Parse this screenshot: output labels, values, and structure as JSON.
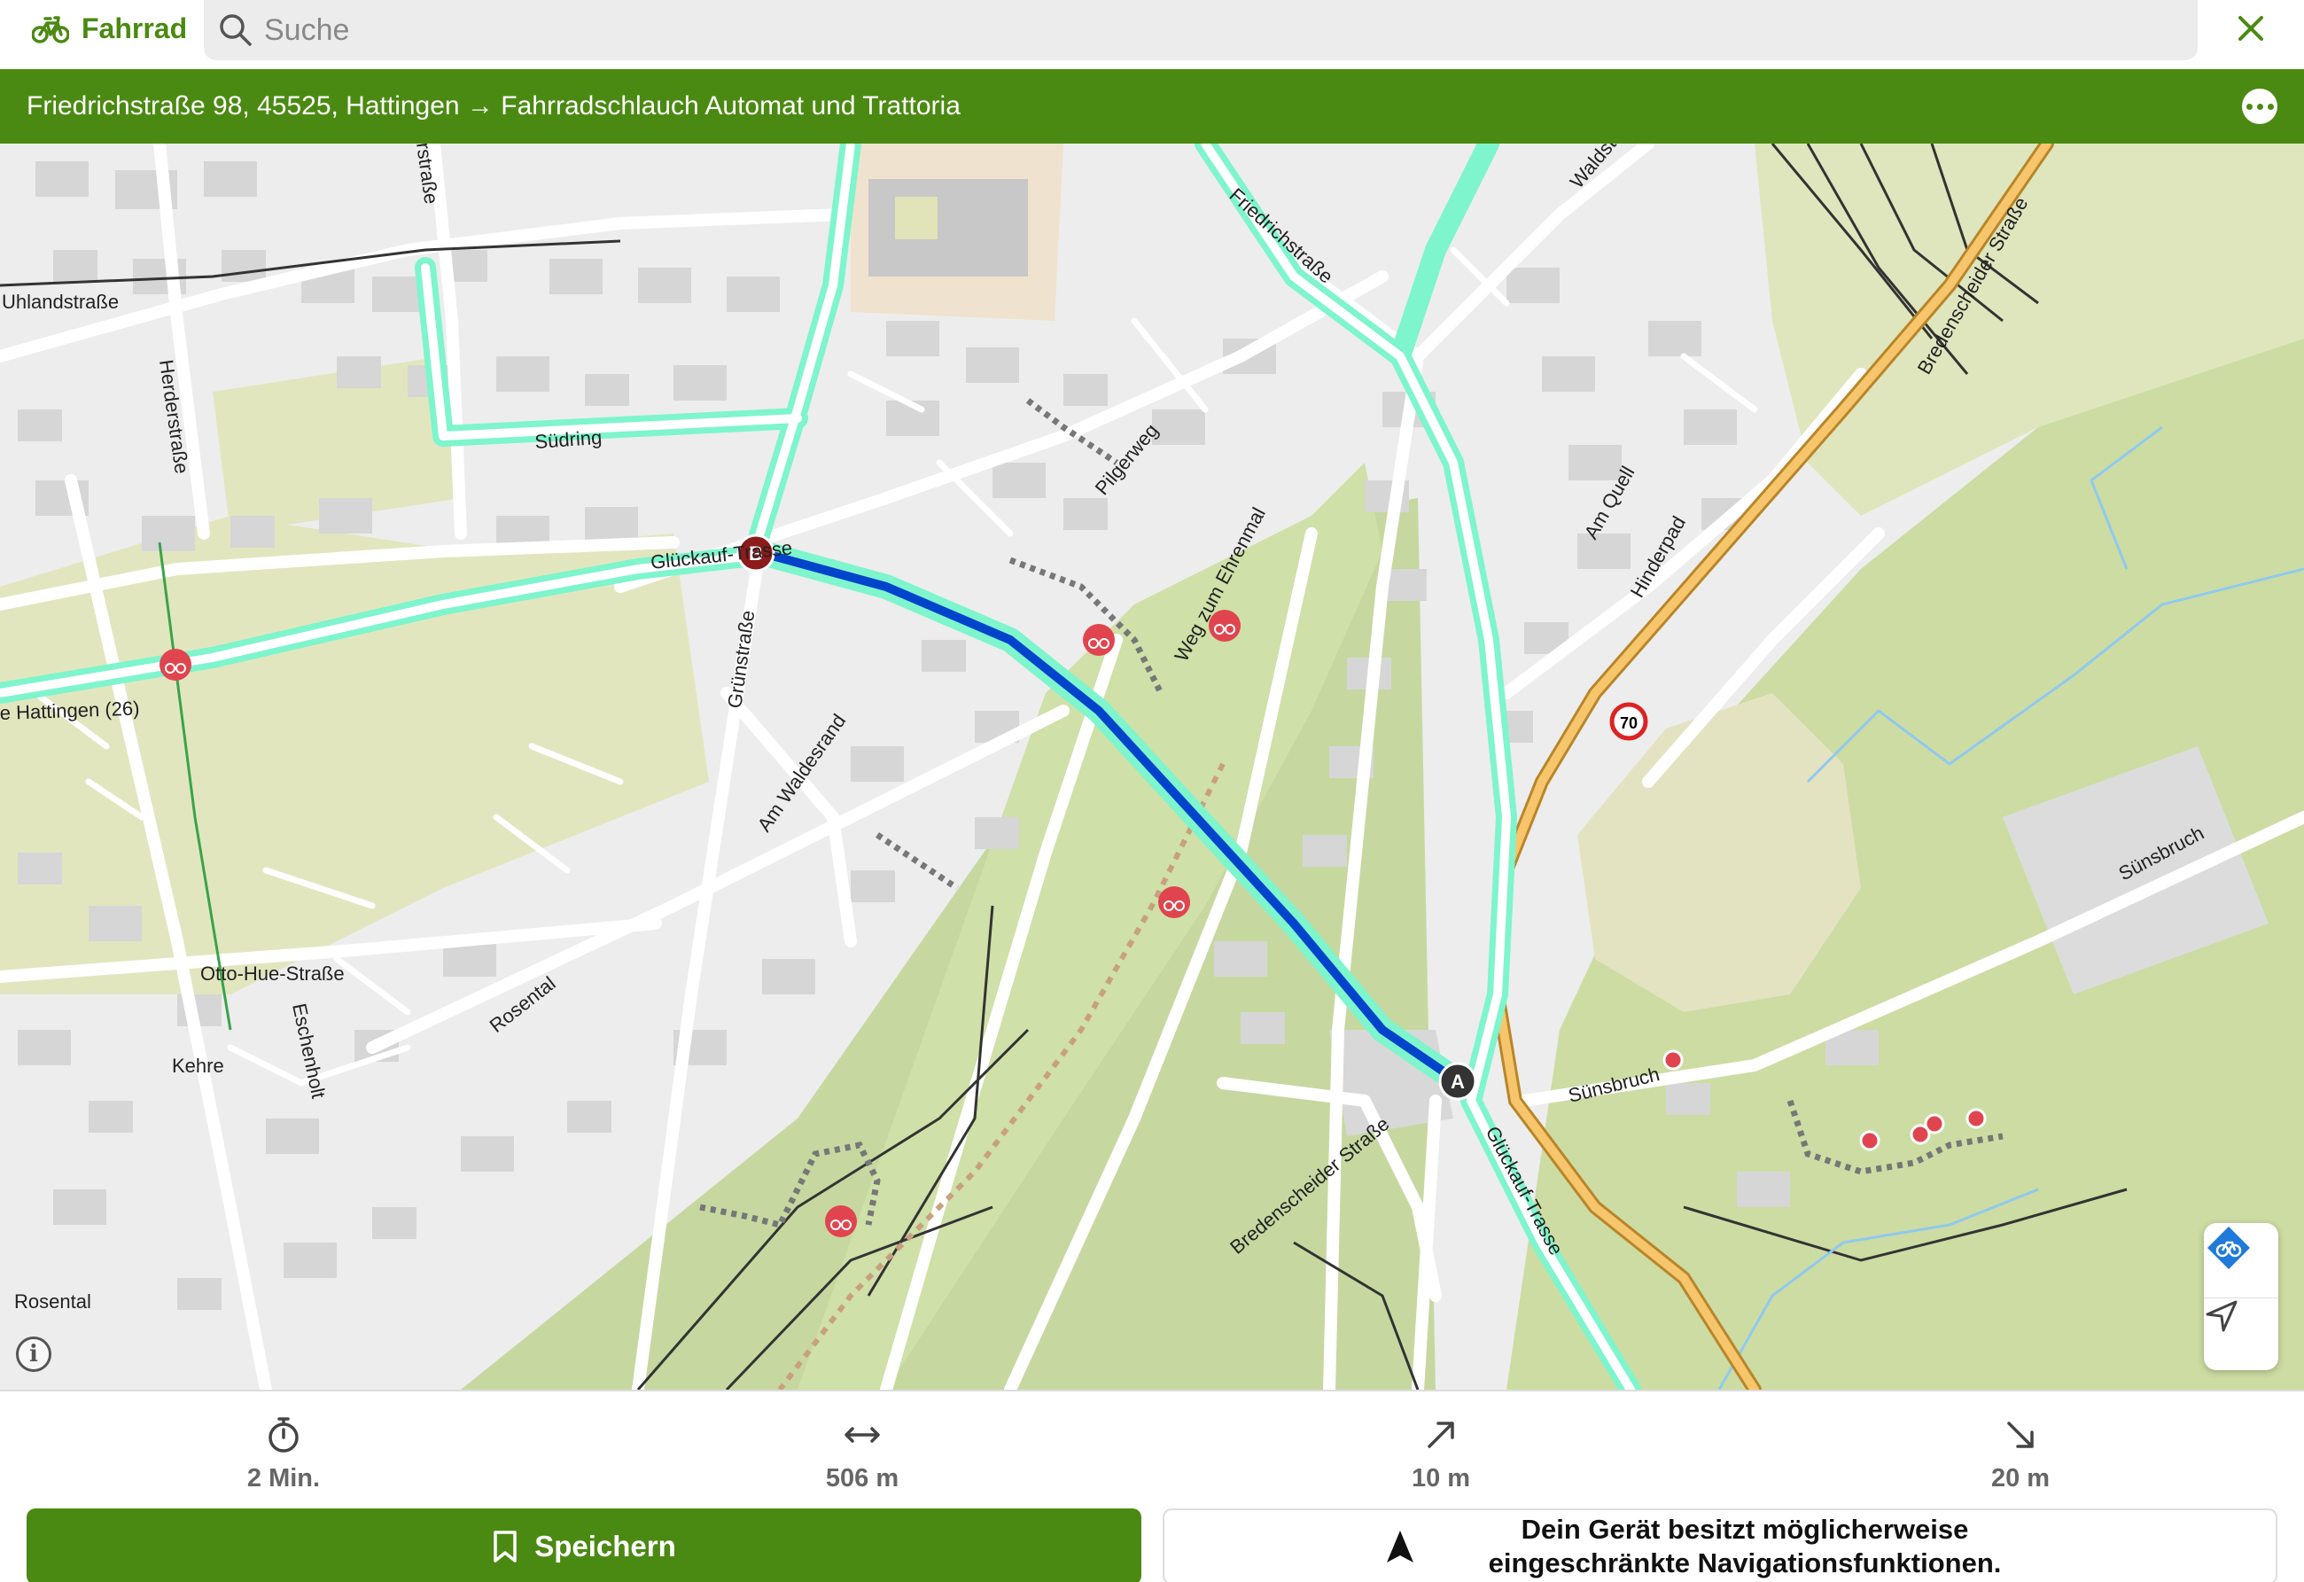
{
  "header": {
    "mode_label": "Fahrrad",
    "search_placeholder": "Suche"
  },
  "route": {
    "title": "Friedrichstraße 98, 45525, Hattingen → Fahrradschlauch Automat und Trattoria"
  },
  "map": {
    "street_labels": [
      "Uhlandstraße",
      "Herderstraße",
      "Südring",
      "Glückauf-Trasse",
      "Grünstraße",
      "Am Waldesrand",
      "Pilgerweg",
      "Weg zum Ehrenmal",
      "Friedrichstraße",
      "Am Quell",
      "Hinderpad",
      "Bredenscheider Straße",
      "Sünsbruch",
      "Sünsbruch",
      "Otto-Hue-Straße",
      "Rosental",
      "Kehre",
      "Eschenholt",
      "Rosental",
      "Bredenscheider Straße",
      "Glückauf-Trasse",
      "e Hattingen (26)",
      "rstraße",
      "Waldst"
    ],
    "markers": {
      "start": "A",
      "end": "B"
    },
    "speed_limit": "70",
    "icons": [
      "bicycle-poi-icon",
      "info-icon",
      "bike-layer-icon",
      "locate-icon"
    ]
  },
  "stats": {
    "duration": "2 Min.",
    "distance": "506 m",
    "ascent": "10 m",
    "descent": "20 m"
  },
  "actions": {
    "save_label": "Speichern",
    "notice": "Dein Gerät besitzt möglicherweise eingeschränkte Navigationsfunktionen."
  },
  "colors": {
    "brand_green": "#4b8a12",
    "route_blue": "#0044cc",
    "cycleway_highlight": "#7ef5cc",
    "poi_red": "#e0454f"
  }
}
